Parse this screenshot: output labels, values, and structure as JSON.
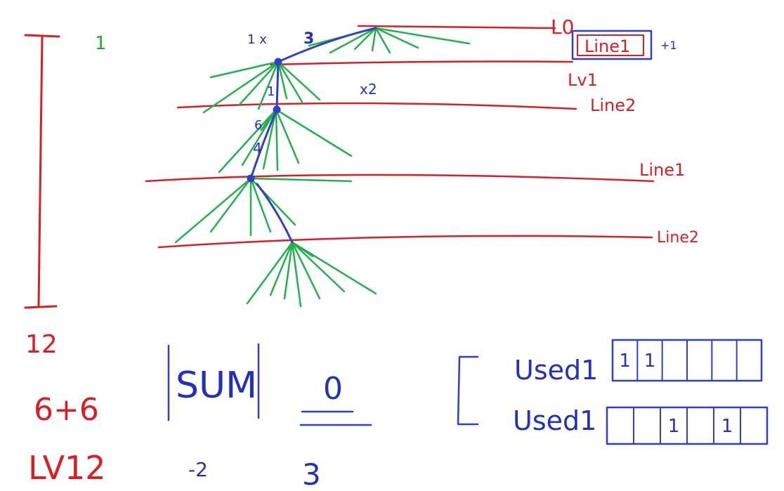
{
  "colors": {
    "red": "#d81f26",
    "green": "#22b14c",
    "blue": "#2f3fc8"
  },
  "labels": {
    "level0": "L0",
    "level1": "Lv1",
    "line1_top": "Line1",
    "plus_one": "+1",
    "line2_a": "Line2",
    "line1_mid": "Line1",
    "line2_b": "Line2",
    "top_left_one": "1",
    "one_x": "1 x",
    "three": "3",
    "one_small": "1",
    "x2": "x2",
    "six_digit": "6",
    "four_digit": "4",
    "twelve": "12",
    "six_plus_six": "6+6",
    "lv12": "LV12",
    "sum": "SUM",
    "zero": "0",
    "minus_two": "-2",
    "three_bottom": "3",
    "used1_a": "Used1",
    "used1_b": "Used1"
  },
  "arrays": {
    "used1_a": [
      "1",
      "1",
      "",
      "",
      "",
      ""
    ],
    "used1_b": [
      "",
      "",
      "1",
      "",
      "1",
      ""
    ]
  }
}
